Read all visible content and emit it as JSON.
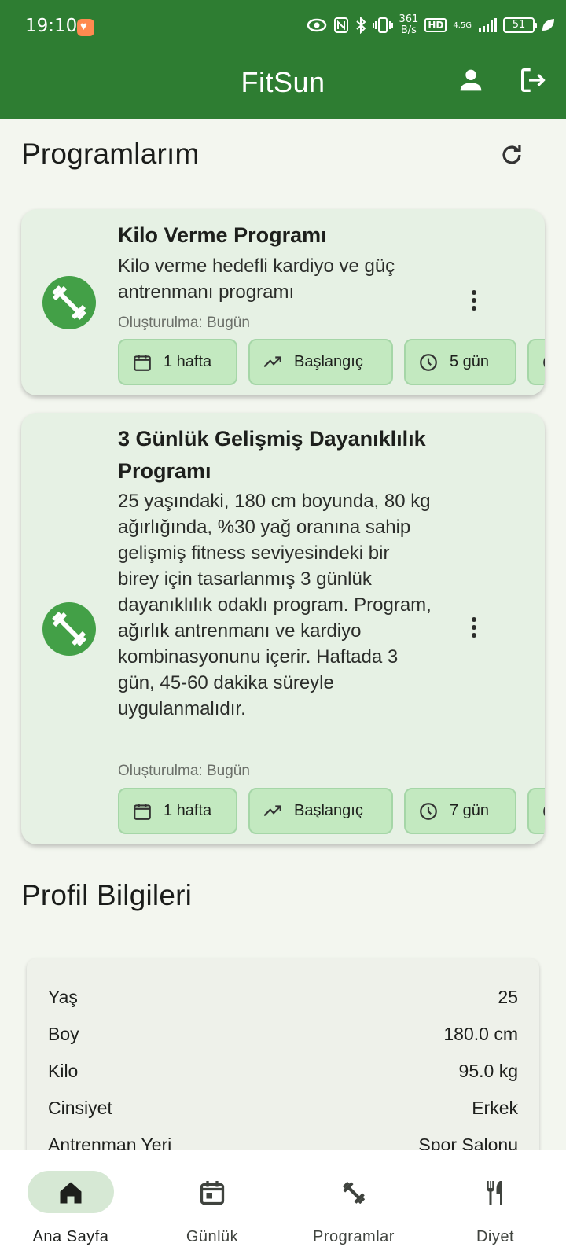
{
  "status_bar": {
    "time": "19:10",
    "net_speed_value": "361",
    "net_speed_unit": "B/s",
    "hd": "HD",
    "signal": "4.5G",
    "battery": "51"
  },
  "app_bar": {
    "title": "FitSun"
  },
  "programs": {
    "title": "Programlarım",
    "items": [
      {
        "title": "Kilo Verme Programı",
        "description": "Kilo verme hedefli kardiyo ve güç antrenmanı programı",
        "created": "Oluşturulma: Bugün",
        "chips": [
          {
            "icon": "calendar-icon",
            "label": "1 hafta"
          },
          {
            "icon": "trending-up-icon",
            "label": "Başlangıç"
          },
          {
            "icon": "clock-icon",
            "label": "5 gün"
          },
          {
            "icon": "check-circle-icon",
            "label": ""
          }
        ]
      },
      {
        "title": "3 Günlük Gelişmiş Dayanıklılık Programı",
        "description": "25 yaşındaki, 180 cm boyunda, 80 kg ağırlığında, %30 yağ oranına sahip gelişmiş fitness seviyesindeki bir birey için tasarlanmış 3 günlük dayanıklılık odaklı program. Program, ağırlık antrenmanı ve kardiyo kombinasyonunu içerir. Haftada 3 gün, 45-60 dakika süreyle uygulanmalıdır.",
        "created": "Oluşturulma: Bugün",
        "chips": [
          {
            "icon": "calendar-icon",
            "label": "1 hafta"
          },
          {
            "icon": "trending-up-icon",
            "label": "Başlangıç"
          },
          {
            "icon": "clock-icon",
            "label": "7 gün"
          },
          {
            "icon": "check-circle-icon",
            "label": ""
          }
        ]
      }
    ]
  },
  "profile": {
    "title": "Profil Bilgileri",
    "rows": [
      {
        "label": "Yaş",
        "value": "25"
      },
      {
        "label": "Boy",
        "value": "180.0 cm"
      },
      {
        "label": "Kilo",
        "value": "95.0 kg"
      },
      {
        "label": "Cinsiyet",
        "value": "Erkek"
      },
      {
        "label": "Antrenman Yeri",
        "value": "Spor Salonu"
      }
    ]
  },
  "bottom_nav": {
    "items": [
      {
        "label": "Ana Sayfa",
        "icon": "home-icon",
        "active": true
      },
      {
        "label": "Günlük",
        "icon": "calendar-today-icon",
        "active": false
      },
      {
        "label": "Programlar",
        "icon": "dumbbell-icon",
        "active": false
      },
      {
        "label": "Diyet",
        "icon": "restaurant-icon",
        "active": false
      }
    ]
  },
  "colors": {
    "primary": "#2e7d32",
    "accent_green": "#43a047",
    "card_bg": "#e6f1e4",
    "chip_bg": "#c3e9c0",
    "nav_active_pill": "#d6e8d4"
  }
}
